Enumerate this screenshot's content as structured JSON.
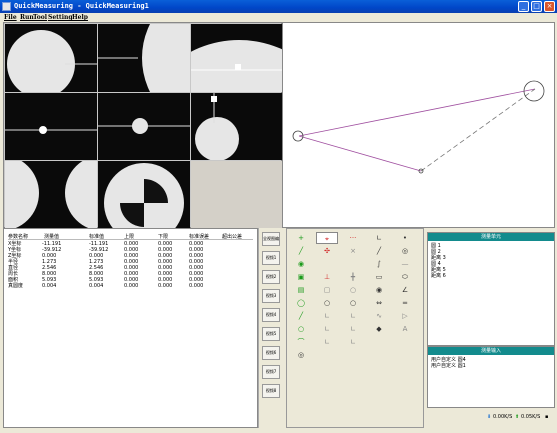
{
  "window": {
    "title": "QuickMeasuring - QuickMeasuring1",
    "minimize_glyph": "_",
    "maximize_glyph": "□",
    "close_glyph": "×"
  },
  "menu": [
    "File",
    "Run",
    "Tool",
    "Setting",
    "Help"
  ],
  "results": {
    "headers": [
      "参数名称",
      "测量值",
      "标准值",
      "上限",
      "下限",
      "标准误差",
      "超出公差"
    ],
    "rows": [
      [
        "X坐标",
        "-11.191",
        "-11.191",
        "0.000",
        "0.000",
        "0.000"
      ],
      [
        "Y坐标",
        "-39.912",
        "-39.912",
        "0.000",
        "0.000",
        "0.000"
      ],
      [
        "Z坐标",
        "0.000",
        "0.000",
        "0.000",
        "0.000",
        "0.000"
      ],
      [
        "半径",
        "1.273",
        "1.273",
        "0.000",
        "0.000",
        "0.000"
      ],
      [
        "直径",
        "2.546",
        "2.546",
        "0.000",
        "0.000",
        "0.000"
      ],
      [
        "周长",
        "8.000",
        "8.000",
        "0.000",
        "0.000",
        "0.000"
      ],
      [
        "面积",
        "5.093",
        "5.093",
        "0.000",
        "0.000",
        "0.000"
      ],
      [
        "真圆度",
        "0.004",
        "0.004",
        "0.000",
        "0.000",
        "0.000"
      ]
    ]
  },
  "views": [
    "全视图编辑",
    "视频1",
    "视频2",
    "视频3",
    "视频4",
    "视频5",
    "视频6",
    "视频7",
    "视频8"
  ],
  "tools": [
    {
      "icon": "plus-icon",
      "glyph": "+",
      "color": "#1a9a1a"
    },
    {
      "icon": "crosshair-icon",
      "glyph": "⌖",
      "color": "#d02020"
    },
    {
      "icon": "dots-icon",
      "glyph": "···",
      "color": "#d02020"
    },
    {
      "icon": "angle-icon",
      "glyph": "∟",
      "color": "#333333"
    },
    {
      "icon": "point-icon",
      "glyph": "•",
      "color": "#333333"
    },
    {
      "icon": "line-icon",
      "glyph": "╱",
      "color": "#1a9a1a"
    },
    {
      "icon": "circle-fit-icon",
      "glyph": "✣",
      "color": "#d02020"
    },
    {
      "icon": "x-icon",
      "glyph": "×",
      "color": "#888888"
    },
    {
      "icon": "slash-icon",
      "glyph": "╱",
      "color": "#333333"
    },
    {
      "icon": "ring-icon",
      "glyph": "◎",
      "color": "#333333"
    },
    {
      "icon": "target-icon",
      "glyph": "◉",
      "color": "#1a9a1a"
    },
    {
      "icon": "blank-icon",
      "glyph": "",
      "color": "#888888"
    },
    {
      "icon": "blank-icon",
      "glyph": "",
      "color": "#888888"
    },
    {
      "icon": "curve-icon",
      "glyph": "∫",
      "color": "#333333"
    },
    {
      "icon": "dash-icon",
      "glyph": "—",
      "color": "#888888"
    },
    {
      "icon": "square-icon",
      "glyph": "▣",
      "color": "#1a9a1a"
    },
    {
      "icon": "perp-icon",
      "glyph": "⊥",
      "color": "#d02020"
    },
    {
      "icon": "cross-icon",
      "glyph": "╋",
      "color": "#888888"
    },
    {
      "icon": "rect-icon",
      "glyph": "▭",
      "color": "#333333"
    },
    {
      "icon": "ellipse-icon",
      "glyph": "⬭",
      "color": "#333333"
    },
    {
      "icon": "box-icon",
      "glyph": "▤",
      "color": "#1a9a1a"
    },
    {
      "icon": "ghost-square-icon",
      "glyph": "▢",
      "color": "#888888"
    },
    {
      "icon": "ghost-circle-icon",
      "glyph": "○",
      "color": "#888888"
    },
    {
      "icon": "bullseye-icon",
      "glyph": "◉",
      "color": "#333333"
    },
    {
      "icon": "angle2-icon",
      "glyph": "∠",
      "color": "#333333"
    },
    {
      "icon": "circle-icon",
      "glyph": "◯",
      "color": "#1a9a1a"
    },
    {
      "icon": "small-circle-icon",
      "glyph": "○",
      "color": "#333333"
    },
    {
      "icon": "small-circle-icon",
      "glyph": "○",
      "color": "#333333"
    },
    {
      "icon": "distance-icon",
      "glyph": "⇔",
      "color": "#333333"
    },
    {
      "icon": "equal-icon",
      "glyph": "═",
      "color": "#333333"
    },
    {
      "icon": "diag-icon",
      "glyph": "╱",
      "color": "#1a9a1a"
    },
    {
      "icon": "angle3-icon",
      "glyph": "∟",
      "color": "#888888"
    },
    {
      "icon": "angle4-icon",
      "glyph": "∟",
      "color": "#888888"
    },
    {
      "icon": "wave-icon",
      "glyph": "∿",
      "color": "#888888"
    },
    {
      "icon": "tag-icon",
      "glyph": "▷",
      "color": "#888888"
    },
    {
      "icon": "ring2-icon",
      "glyph": "○",
      "color": "#1a9a1a"
    },
    {
      "icon": "angle5-icon",
      "glyph": "∟",
      "color": "#888888"
    },
    {
      "icon": "angle6-icon",
      "glyph": "∟",
      "color": "#888888"
    },
    {
      "icon": "eraser-icon",
      "glyph": "◆",
      "color": "#333333"
    },
    {
      "icon": "letter-icon",
      "glyph": "A",
      "color": "#888888"
    },
    {
      "icon": "arc-icon",
      "glyph": "⌒",
      "color": "#1a9a1a"
    },
    {
      "icon": "angle7-icon",
      "glyph": "∟",
      "color": "#888888"
    },
    {
      "icon": "angle8-icon",
      "glyph": "∟",
      "color": "#888888"
    },
    {
      "icon": "blank-icon",
      "glyph": "",
      "color": "#888888"
    },
    {
      "icon": "blank-icon",
      "glyph": "",
      "color": "#888888"
    },
    {
      "icon": "gear-icon",
      "glyph": "◎",
      "color": "#333333"
    }
  ],
  "unit_panel": {
    "title": "测量单元",
    "items": [
      "圆 1",
      "圆 2",
      "距离 3",
      "圆 4",
      "距离 5",
      "距离 6"
    ]
  },
  "input_panel": {
    "title": "测量输入",
    "items": [
      "用户自定义 圆4",
      "用户自定义 圆1"
    ]
  },
  "status": {
    "speed1": "0.00K/S",
    "speed2": "0.05K/S"
  },
  "colors": {
    "title_bar": "#0046c8",
    "panel_header": "#138b8d",
    "construction_line": "#a050a0"
  }
}
